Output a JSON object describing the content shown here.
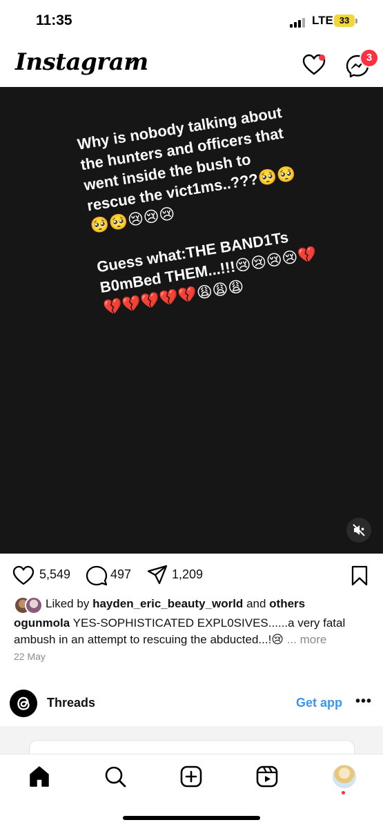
{
  "status_bar": {
    "time": "11:35",
    "network": "LTE",
    "battery": "33"
  },
  "header": {
    "app_name": "Instagram",
    "messages_badge": "3"
  },
  "post": {
    "media_text": "Why is nobody talking about the hunters and officers that went inside the bush to rescue the vict1ms..???🥺🥺🥺🥺😢😢😢\n\nGuess what:THE BAND1Ts B0mBed THEM...!!!😢😢😢😢💔💔💔💔💔💔😩😩😩",
    "likes": "5,549",
    "comments": "497",
    "shares": "1,209",
    "liked_by_prefix": "Liked by",
    "liked_by_user": "hayden_eric_beauty_world",
    "liked_by_and": "and",
    "liked_by_others": "others",
    "caption_user": "ogunmola",
    "caption_text": "YES-SOPHISTICATED EXPL0SIVES......a very fatal ambush in an attempt to rescuing the abducted...!😢",
    "caption_more": "... more",
    "date": "22 May"
  },
  "threads": {
    "label": "Threads",
    "cta": "Get app",
    "more": "•••"
  },
  "colors": {
    "accent_blue": "#3797f0",
    "notification_red": "#ff3040",
    "media_bg": "#161616"
  },
  "icons": [
    "heart-icon",
    "messenger-icon",
    "mute-icon",
    "like-icon",
    "comment-icon",
    "share-icon",
    "save-icon",
    "threads-icon",
    "home-icon",
    "search-icon",
    "create-icon",
    "reels-icon"
  ]
}
